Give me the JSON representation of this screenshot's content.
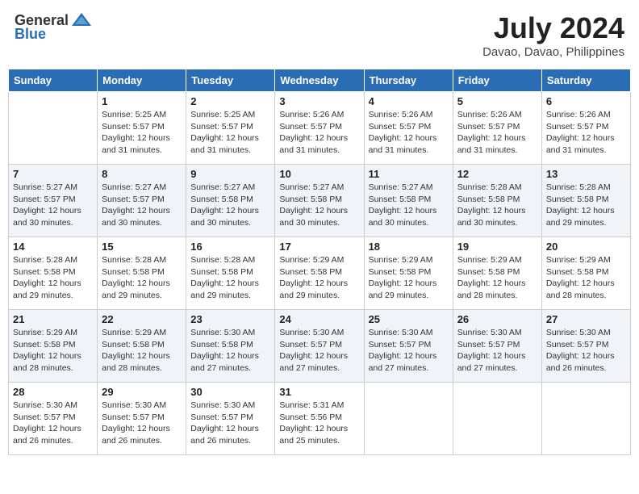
{
  "header": {
    "logo_general": "General",
    "logo_blue": "Blue",
    "month_title": "July 2024",
    "subtitle": "Davao, Davao, Philippines"
  },
  "days_of_week": [
    "Sunday",
    "Monday",
    "Tuesday",
    "Wednesday",
    "Thursday",
    "Friday",
    "Saturday"
  ],
  "weeks": [
    [
      {
        "day": "",
        "info": ""
      },
      {
        "day": "1",
        "info": "Sunrise: 5:25 AM\nSunset: 5:57 PM\nDaylight: 12 hours\nand 31 minutes."
      },
      {
        "day": "2",
        "info": "Sunrise: 5:25 AM\nSunset: 5:57 PM\nDaylight: 12 hours\nand 31 minutes."
      },
      {
        "day": "3",
        "info": "Sunrise: 5:26 AM\nSunset: 5:57 PM\nDaylight: 12 hours\nand 31 minutes."
      },
      {
        "day": "4",
        "info": "Sunrise: 5:26 AM\nSunset: 5:57 PM\nDaylight: 12 hours\nand 31 minutes."
      },
      {
        "day": "5",
        "info": "Sunrise: 5:26 AM\nSunset: 5:57 PM\nDaylight: 12 hours\nand 31 minutes."
      },
      {
        "day": "6",
        "info": "Sunrise: 5:26 AM\nSunset: 5:57 PM\nDaylight: 12 hours\nand 31 minutes."
      }
    ],
    [
      {
        "day": "7",
        "info": "Sunrise: 5:27 AM\nSunset: 5:57 PM\nDaylight: 12 hours\nand 30 minutes."
      },
      {
        "day": "8",
        "info": "Sunrise: 5:27 AM\nSunset: 5:57 PM\nDaylight: 12 hours\nand 30 minutes."
      },
      {
        "day": "9",
        "info": "Sunrise: 5:27 AM\nSunset: 5:58 PM\nDaylight: 12 hours\nand 30 minutes."
      },
      {
        "day": "10",
        "info": "Sunrise: 5:27 AM\nSunset: 5:58 PM\nDaylight: 12 hours\nand 30 minutes."
      },
      {
        "day": "11",
        "info": "Sunrise: 5:27 AM\nSunset: 5:58 PM\nDaylight: 12 hours\nand 30 minutes."
      },
      {
        "day": "12",
        "info": "Sunrise: 5:28 AM\nSunset: 5:58 PM\nDaylight: 12 hours\nand 30 minutes."
      },
      {
        "day": "13",
        "info": "Sunrise: 5:28 AM\nSunset: 5:58 PM\nDaylight: 12 hours\nand 29 minutes."
      }
    ],
    [
      {
        "day": "14",
        "info": "Sunrise: 5:28 AM\nSunset: 5:58 PM\nDaylight: 12 hours\nand 29 minutes."
      },
      {
        "day": "15",
        "info": "Sunrise: 5:28 AM\nSunset: 5:58 PM\nDaylight: 12 hours\nand 29 minutes."
      },
      {
        "day": "16",
        "info": "Sunrise: 5:28 AM\nSunset: 5:58 PM\nDaylight: 12 hours\nand 29 minutes."
      },
      {
        "day": "17",
        "info": "Sunrise: 5:29 AM\nSunset: 5:58 PM\nDaylight: 12 hours\nand 29 minutes."
      },
      {
        "day": "18",
        "info": "Sunrise: 5:29 AM\nSunset: 5:58 PM\nDaylight: 12 hours\nand 29 minutes."
      },
      {
        "day": "19",
        "info": "Sunrise: 5:29 AM\nSunset: 5:58 PM\nDaylight: 12 hours\nand 28 minutes."
      },
      {
        "day": "20",
        "info": "Sunrise: 5:29 AM\nSunset: 5:58 PM\nDaylight: 12 hours\nand 28 minutes."
      }
    ],
    [
      {
        "day": "21",
        "info": "Sunrise: 5:29 AM\nSunset: 5:58 PM\nDaylight: 12 hours\nand 28 minutes."
      },
      {
        "day": "22",
        "info": "Sunrise: 5:29 AM\nSunset: 5:58 PM\nDaylight: 12 hours\nand 28 minutes."
      },
      {
        "day": "23",
        "info": "Sunrise: 5:30 AM\nSunset: 5:58 PM\nDaylight: 12 hours\nand 27 minutes."
      },
      {
        "day": "24",
        "info": "Sunrise: 5:30 AM\nSunset: 5:57 PM\nDaylight: 12 hours\nand 27 minutes."
      },
      {
        "day": "25",
        "info": "Sunrise: 5:30 AM\nSunset: 5:57 PM\nDaylight: 12 hours\nand 27 minutes."
      },
      {
        "day": "26",
        "info": "Sunrise: 5:30 AM\nSunset: 5:57 PM\nDaylight: 12 hours\nand 27 minutes."
      },
      {
        "day": "27",
        "info": "Sunrise: 5:30 AM\nSunset: 5:57 PM\nDaylight: 12 hours\nand 26 minutes."
      }
    ],
    [
      {
        "day": "28",
        "info": "Sunrise: 5:30 AM\nSunset: 5:57 PM\nDaylight: 12 hours\nand 26 minutes."
      },
      {
        "day": "29",
        "info": "Sunrise: 5:30 AM\nSunset: 5:57 PM\nDaylight: 12 hours\nand 26 minutes."
      },
      {
        "day": "30",
        "info": "Sunrise: 5:30 AM\nSunset: 5:57 PM\nDaylight: 12 hours\nand 26 minutes."
      },
      {
        "day": "31",
        "info": "Sunrise: 5:31 AM\nSunset: 5:56 PM\nDaylight: 12 hours\nand 25 minutes."
      },
      {
        "day": "",
        "info": ""
      },
      {
        "day": "",
        "info": ""
      },
      {
        "day": "",
        "info": ""
      }
    ]
  ]
}
